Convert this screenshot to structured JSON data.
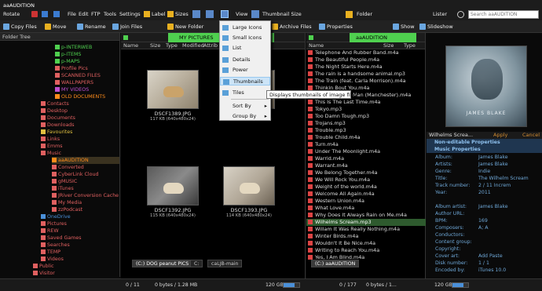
{
  "app": {
    "title": "aaAUDITION"
  },
  "toolbar1": {
    "rotate": "Rotate",
    "file": "File",
    "edit": "Edit",
    "ftp": "FTP",
    "tools": "Tools",
    "settings": "Settings",
    "label": "Label",
    "sizes": "Sizes",
    "view": "View",
    "thumb_size": "Thumbnail Size",
    "folder": "Folder",
    "lister": "Lister",
    "search_value": "Search aaAUDITION"
  },
  "toolbar2": {
    "copy_files": "Copy Files",
    "move": "Move",
    "rename": "Rename",
    "join_files": "Join Files",
    "new_folder": "New Folder",
    "archive_files": "Archive Files",
    "properties": "Properties",
    "show": "Show",
    "slideshow": "Slideshow"
  },
  "tree": {
    "header": "Folder Tree",
    "items": [
      {
        "label": "p-INTERWEB",
        "color": "#4fd04f"
      },
      {
        "label": "p-ITEMS",
        "color": "#4fd04f"
      },
      {
        "label": "p-MAPS",
        "color": "#4fd04f"
      },
      {
        "label": "Profile Pics",
        "color": "#e06060"
      },
      {
        "label": "SCANNED FILES",
        "color": "#e06060"
      },
      {
        "label": "WALLPAPERS",
        "color": "#e06060"
      },
      {
        "label": "MY VIDEOS",
        "color": "#c04fd0"
      },
      {
        "label": "OLD DOCUMENTS",
        "color": "#ff8c1a"
      },
      {
        "label": "Contacts",
        "color": "#e06060"
      },
      {
        "label": "Desktop",
        "color": "#e06060"
      },
      {
        "label": "Documents",
        "color": "#e06060"
      },
      {
        "label": "Downloads",
        "color": "#e06060"
      },
      {
        "label": "Favourites",
        "color": "#e0c040"
      },
      {
        "label": "Links",
        "color": "#e06060"
      },
      {
        "label": "Emms",
        "color": "#e06060"
      },
      {
        "label": "Music",
        "color": "#e06060"
      },
      {
        "label": "aaAUDITION",
        "color": "#ff8c1a"
      },
      {
        "label": "Converted",
        "color": "#e06060"
      },
      {
        "label": "CyberLink Cloud",
        "color": "#e06060"
      },
      {
        "label": "gMUSIC",
        "color": "#e06060"
      },
      {
        "label": "iTunes",
        "color": "#e06060"
      },
      {
        "label": "JRiver Conversion Cache",
        "color": "#e06060"
      },
      {
        "label": "My Media",
        "color": "#e06060"
      },
      {
        "label": "zzPodcast",
        "color": "#e06060"
      },
      {
        "label": "OneDrive",
        "color": "#4a90d9"
      },
      {
        "label": "Pictures",
        "color": "#e06060"
      },
      {
        "label": "REW",
        "color": "#e06060"
      },
      {
        "label": "Saved Games",
        "color": "#e06060"
      },
      {
        "label": "Searches",
        "color": "#e06060"
      },
      {
        "label": "TEMP",
        "color": "#e06060"
      },
      {
        "label": "Videos",
        "color": "#e06060"
      },
      {
        "label": "Public",
        "color": "#e06060"
      },
      {
        "label": "Visitor",
        "color": "#e06060"
      },
      {
        "label": "Windows",
        "color": "#e06060"
      }
    ]
  },
  "thumbs": {
    "path": "MY PICTURES",
    "cols": [
      "Name",
      "Size",
      "Type",
      "Modified",
      "Attrib"
    ],
    "items": [
      {
        "name": "DSCF1389.JPG",
        "info": "117 KB (640x480x24)"
      },
      {
        "name": "DSCF1390.JPG",
        "info": "118 KB (640x480x24)"
      },
      {
        "name": "DSCF1392.JPG",
        "info": "115 KB (640x480x24)"
      },
      {
        "name": "DSCF1393.JPG",
        "info": "114 KB (640x480x24)"
      }
    ],
    "tab1": "(C:) DOG peanut PICS",
    "tab2": "C:",
    "tab3": "caLJB-main"
  },
  "menu": {
    "items": [
      "Large Icons",
      "Small Icons",
      "List",
      "Details",
      "Power",
      "Thumbnails",
      "Tiles",
      "Sort By",
      "Group By"
    ],
    "tooltip": "Displays thumbnails of image files"
  },
  "list": {
    "path": "aaAUDITION",
    "cols": [
      "Name",
      "Size",
      "Type"
    ],
    "tab": "(C:) aaAUDITION",
    "files": [
      "Telephone And Rubber Band.m4a",
      "The Beautiful People.m4a",
      "The Night Starts Here.m4a",
      "The rain is a handsome animal.mp3",
      "The Train (feat. Carla Morrison).m4a",
      "Thinkin Bout You.m4a",
      "This Charming Man (Manchester).m4a",
      "This Is The Last Time.m4a",
      "Tokyo.mp3",
      "Too Damn Tough.mp3",
      "Trojans.mp3",
      "Trouble.mp3",
      "Trouble Child.m4a",
      "Turn.m4a",
      "Under The Moonlight.m4a",
      "Warrid.m4a",
      "Warrant.m4a",
      "We Belong Together.m4a",
      "We Will Rock You.m4a",
      "Weight of the world.m4a",
      "Welcome All Again.m4a",
      "Western Union.m4a",
      "What Love.m4a",
      "Why Does It Always Rain on Me.m4a",
      "Wilhelms Scream.mp3",
      "Willam It Was Really Nothing.m4a",
      "Winter Birds.m4a",
      "Wouldn't It Be Nice.m4a",
      "Writing to Reach You.m4a",
      "Yes, I Am Blind.m4a"
    ],
    "selected": "Wilhelms Scream.mp3"
  },
  "right": {
    "title": "Wilhelms Screa...",
    "art_text": "JAMES BLAKE",
    "apply": "Apply",
    "cancel": "Cancel",
    "sect1": "Non-editable Properties",
    "sect2": "Music Properties",
    "props": [
      {
        "k": "Album:",
        "v": "James Blake"
      },
      {
        "k": "Artists:",
        "v": "James Blake"
      },
      {
        "k": "Genre:",
        "v": "Indie"
      },
      {
        "k": "Title:",
        "v": "The Wilhelm Scream"
      },
      {
        "k": "Track number:",
        "v": "2    /    11      Increm"
      },
      {
        "k": "Year:",
        "v": "2011"
      },
      {
        "k": "",
        "v": ""
      },
      {
        "k": "Album artist:",
        "v": "James Blake"
      },
      {
        "k": "Author URL:",
        "v": ""
      },
      {
        "k": "BPM:",
        "v": "169"
      },
      {
        "k": "Composers:",
        "v": "A; A"
      },
      {
        "k": "Conductors:",
        "v": ""
      },
      {
        "k": "Content group:",
        "v": ""
      },
      {
        "k": "Copyright:",
        "v": ""
      },
      {
        "k": "Cover art:",
        "v": "      Add      Paste"
      },
      {
        "k": "Disk number:",
        "v": "1    /    1"
      },
      {
        "k": "Encoded by:",
        "v": "iTunes 10.0"
      }
    ]
  },
  "status": {
    "left": "0 / 11",
    "bytes": "0 bytes / 1.28 MB",
    "disk1": "120 GB",
    "count2": "0 / 177",
    "bytes2": "0 bytes / 1...",
    "disk2": "120 GB"
  }
}
